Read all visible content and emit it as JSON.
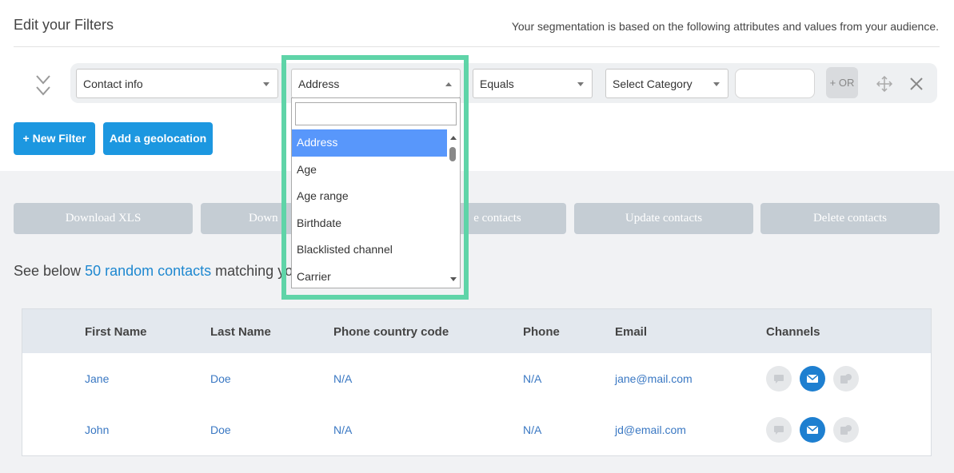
{
  "filters": {
    "title": "Edit your Filters",
    "description": "Your segmentation is based on the following attributes and values from your audience.",
    "row": {
      "category": "Contact info",
      "attribute": "Address",
      "operator": "Equals",
      "value_select": "Select Category",
      "value_input": "",
      "or_label": "+ OR"
    },
    "new_filter_label": "+ New Filter",
    "geolocation_label": "Add a geolocation"
  },
  "dropdown": {
    "search_value": "",
    "options": [
      "Address",
      "Age",
      "Age range",
      "Birthdate",
      "Blacklisted channel",
      "Carrier"
    ],
    "selected": "Address"
  },
  "actions": {
    "download_xls": "Download XLS",
    "download_csv_partial": "Down",
    "create_partial": "e contacts",
    "update": "Update contacts",
    "delete": "Delete contacts"
  },
  "random": {
    "prefix": "See below ",
    "link": "50 random contacts",
    "suffix_partial": " matching yo"
  },
  "table": {
    "columns": [
      "First Name",
      "Last Name",
      "Phone country code",
      "Phone",
      "Email",
      "Channels"
    ],
    "rows": [
      {
        "first": "Jane",
        "last": "Doe",
        "country_code": "N/A",
        "phone": "N/A",
        "email": "jane@mail.com"
      },
      {
        "first": "John",
        "last": "Doe",
        "country_code": "N/A",
        "phone": "N/A",
        "email": "jd@email.com"
      }
    ],
    "channel_icons": [
      "sms-icon",
      "email-icon",
      "whatsapp-icon"
    ]
  },
  "colors": {
    "primary": "#1c97e0",
    "disabled": "#c5cdd4",
    "highlight": "#5fd4a8",
    "selected_option": "#5897fb",
    "link": "#1e88d0"
  }
}
